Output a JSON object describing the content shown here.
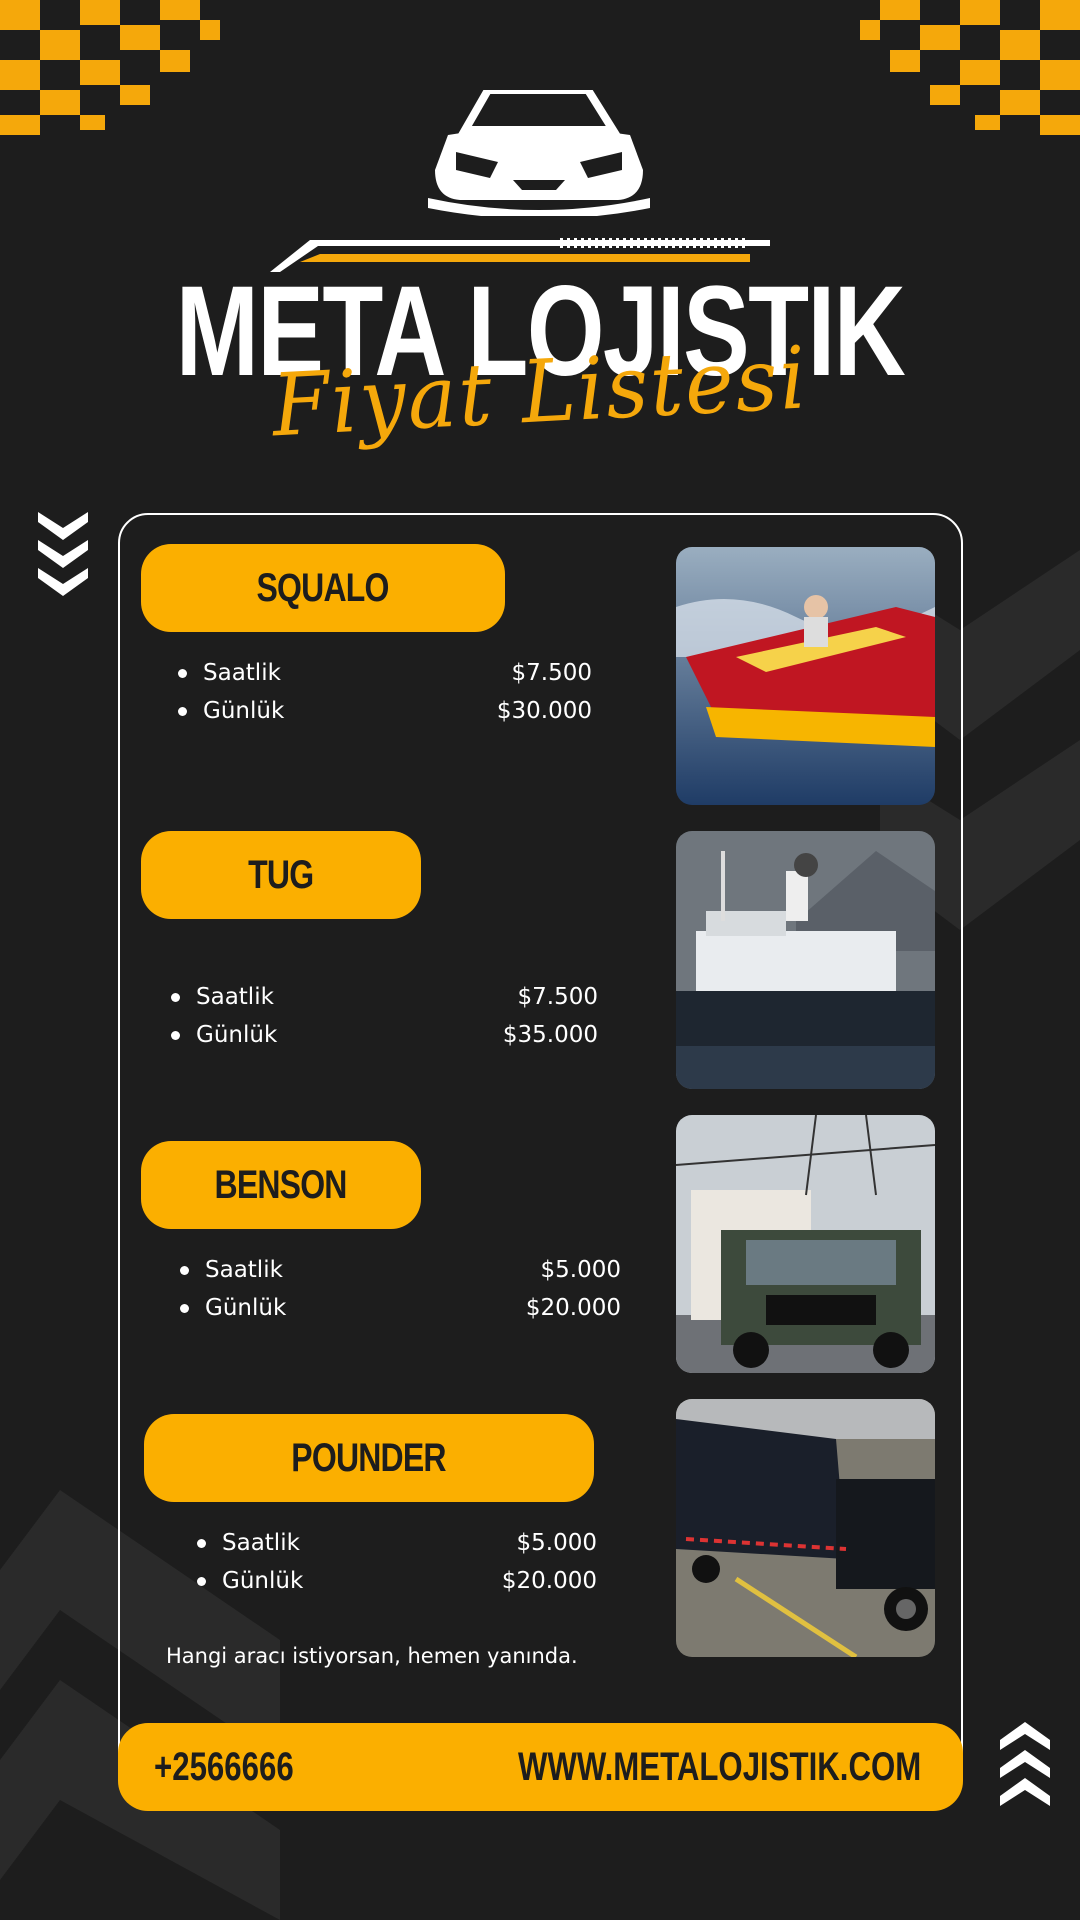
{
  "header": {
    "brand": "META LOJISTIK",
    "subtitle": "Fiyat Listesi"
  },
  "vehicles": [
    {
      "name": "SQUALO",
      "rows": [
        {
          "label": "Saatlik",
          "price": "$7.500"
        },
        {
          "label": "Günlük",
          "price": "$30.000"
        }
      ],
      "image": "speedboat-photo"
    },
    {
      "name": "TUG",
      "rows": [
        {
          "label": "Saatlik",
          "price": "$7.500"
        },
        {
          "label": "Günlük",
          "price": "$35.000"
        }
      ],
      "image": "tugboat-photo"
    },
    {
      "name": "BENSON",
      "rows": [
        {
          "label": "Saatlik",
          "price": "$5.000"
        },
        {
          "label": "Günlük",
          "price": "$20.000"
        }
      ],
      "image": "box-truck-photo"
    },
    {
      "name": "POUNDER",
      "rows": [
        {
          "label": "Saatlik",
          "price": "$5.000"
        },
        {
          "label": "Günlük",
          "price": "$20.000"
        }
      ],
      "image": "semi-truck-photo"
    }
  ],
  "tagline": "Hangi aracı istiyorsan, hemen yanında.",
  "footer": {
    "phone": "+2566666",
    "website": "WWW.METALOJISTIK.COM"
  },
  "colors": {
    "background": "#1d1d1d",
    "accent": "#fbaf00",
    "text": "#ffffff"
  }
}
